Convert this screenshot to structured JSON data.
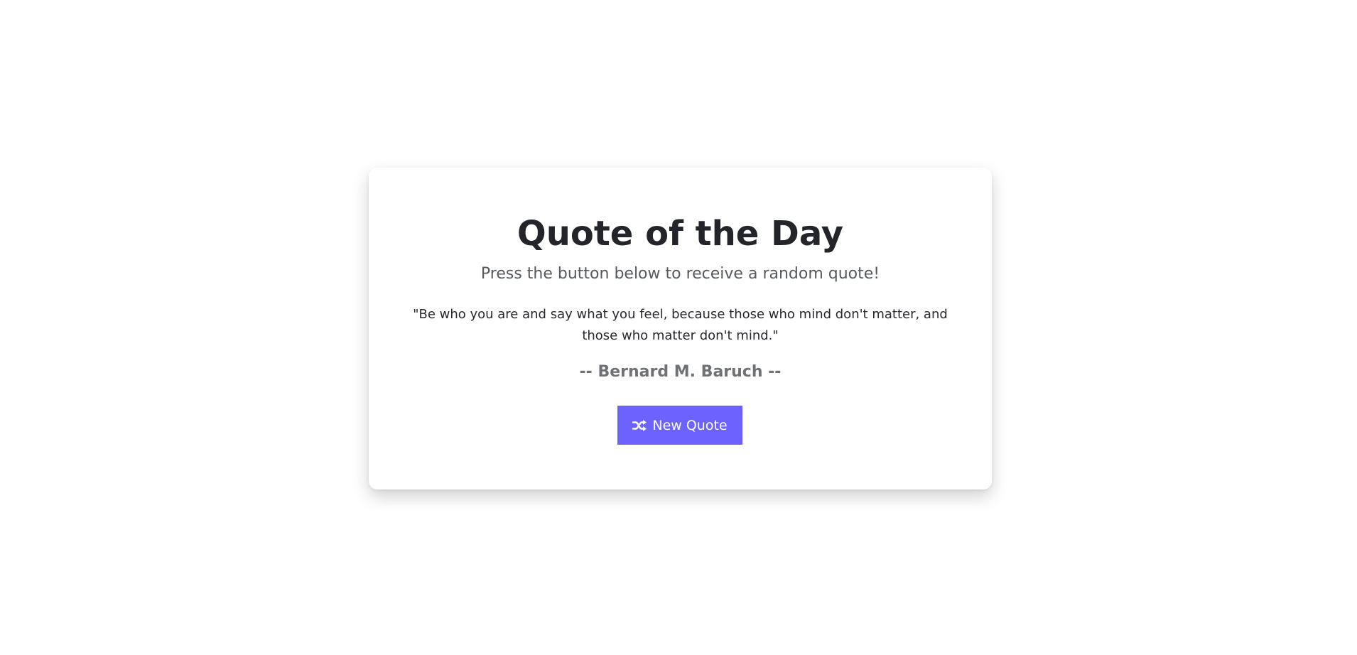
{
  "card": {
    "title": "Quote of the Day",
    "subtitle": "Press the button below to receive a random quote!",
    "quote": "\"Be who you are and say what you feel, because those who mind don't matter, and those who matter don't mind.\"",
    "author": "-- Bernard M. Baruch --",
    "button_label": "New Quote",
    "button_icon": "shuffle-icon"
  },
  "colors": {
    "accent": "#6c63ff",
    "title": "#23252b",
    "subtitle": "#555a5f",
    "author": "#6f7174"
  }
}
